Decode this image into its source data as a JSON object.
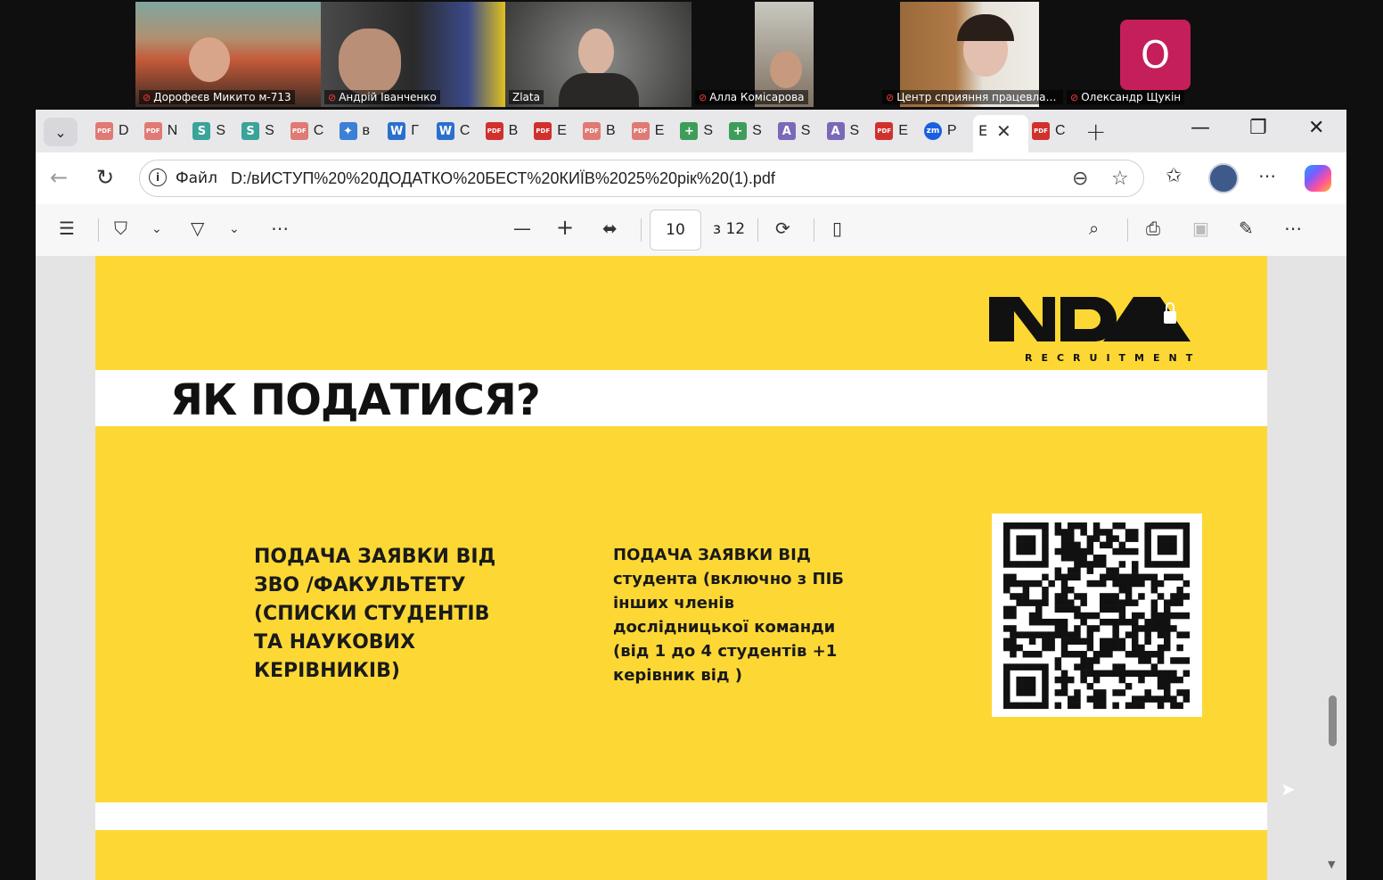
{
  "meeting": {
    "participants": [
      {
        "name": "Дорофеєв Микито м-713",
        "muted": true
      },
      {
        "name": "Андрій Іванченко",
        "muted": true
      },
      {
        "name": "Zlata",
        "muted": false
      },
      {
        "name": "Алла Комісарова",
        "muted": true
      },
      {
        "name": "Центр сприяння працевлашт...",
        "muted": true
      },
      {
        "name": "Олександр Щукін",
        "muted": true
      }
    ],
    "avatar_letter": "O",
    "avatar_color": "#c41f5a",
    "mute_icon": "muted-mic-icon"
  },
  "tabs": {
    "items": [
      {
        "icon": "pdf",
        "letter": "D"
      },
      {
        "icon": "pdf",
        "letter": "N"
      },
      {
        "icon": "sheets",
        "letter": "S"
      },
      {
        "icon": "sheets",
        "letter": "S"
      },
      {
        "icon": "pdf",
        "letter": "C"
      },
      {
        "icon": "app",
        "letter": "в"
      },
      {
        "icon": "word",
        "letter": "Г"
      },
      {
        "icon": "word",
        "letter": "C"
      },
      {
        "icon": "pdf-red",
        "letter": "B"
      },
      {
        "icon": "pdf-red",
        "letter": "E"
      },
      {
        "icon": "pdf",
        "letter": "B"
      },
      {
        "icon": "pdf",
        "letter": "E"
      },
      {
        "icon": "plus-green",
        "letter": "S"
      },
      {
        "icon": "plus-green",
        "letter": "S"
      },
      {
        "icon": "a-purple",
        "letter": "S"
      },
      {
        "icon": "a-purple",
        "letter": "S"
      },
      {
        "icon": "pdf-red",
        "letter": "E"
      },
      {
        "icon": "zm",
        "letter": "P"
      }
    ],
    "active_letter": "E",
    "after_letter": "C",
    "close_glyph": "✕",
    "new_tab_glyph": "+"
  },
  "window": {
    "minimize": "—",
    "restore": "❐",
    "close": "✕"
  },
  "address": {
    "site_label": "Файл",
    "url": "D:/вИСТУП%20%20ДОДАТКО%20БЕСТ%20КИЇВ%2025%20рік%20(1).pdf"
  },
  "pdf_toolbar": {
    "page_current": "10",
    "page_total": "з 12"
  },
  "slide": {
    "title": "ЯК ПОДАТИСЯ?",
    "logo_text": "NDA",
    "logo_sub": "RECRUITMENT",
    "col1_lines": [
      "ПОДАЧА ЗАЯВКИ ВІД",
      "ЗВО /ФАКУЛЬТЕТУ",
      "(СПИСКИ СТУДЕНТІВ",
      "ТА НАУКОВИХ",
      "КЕРІВНИКІВ)"
    ],
    "col2_lines": [
      "ПОДАЧА ЗАЯВКИ ВІД",
      "студента (включно з ПІБ",
      "інших членів",
      "дослідницької команди",
      "(від 1 до 4 студентів +1",
      "керівник від )"
    ],
    "background_color": "#fdd835"
  }
}
